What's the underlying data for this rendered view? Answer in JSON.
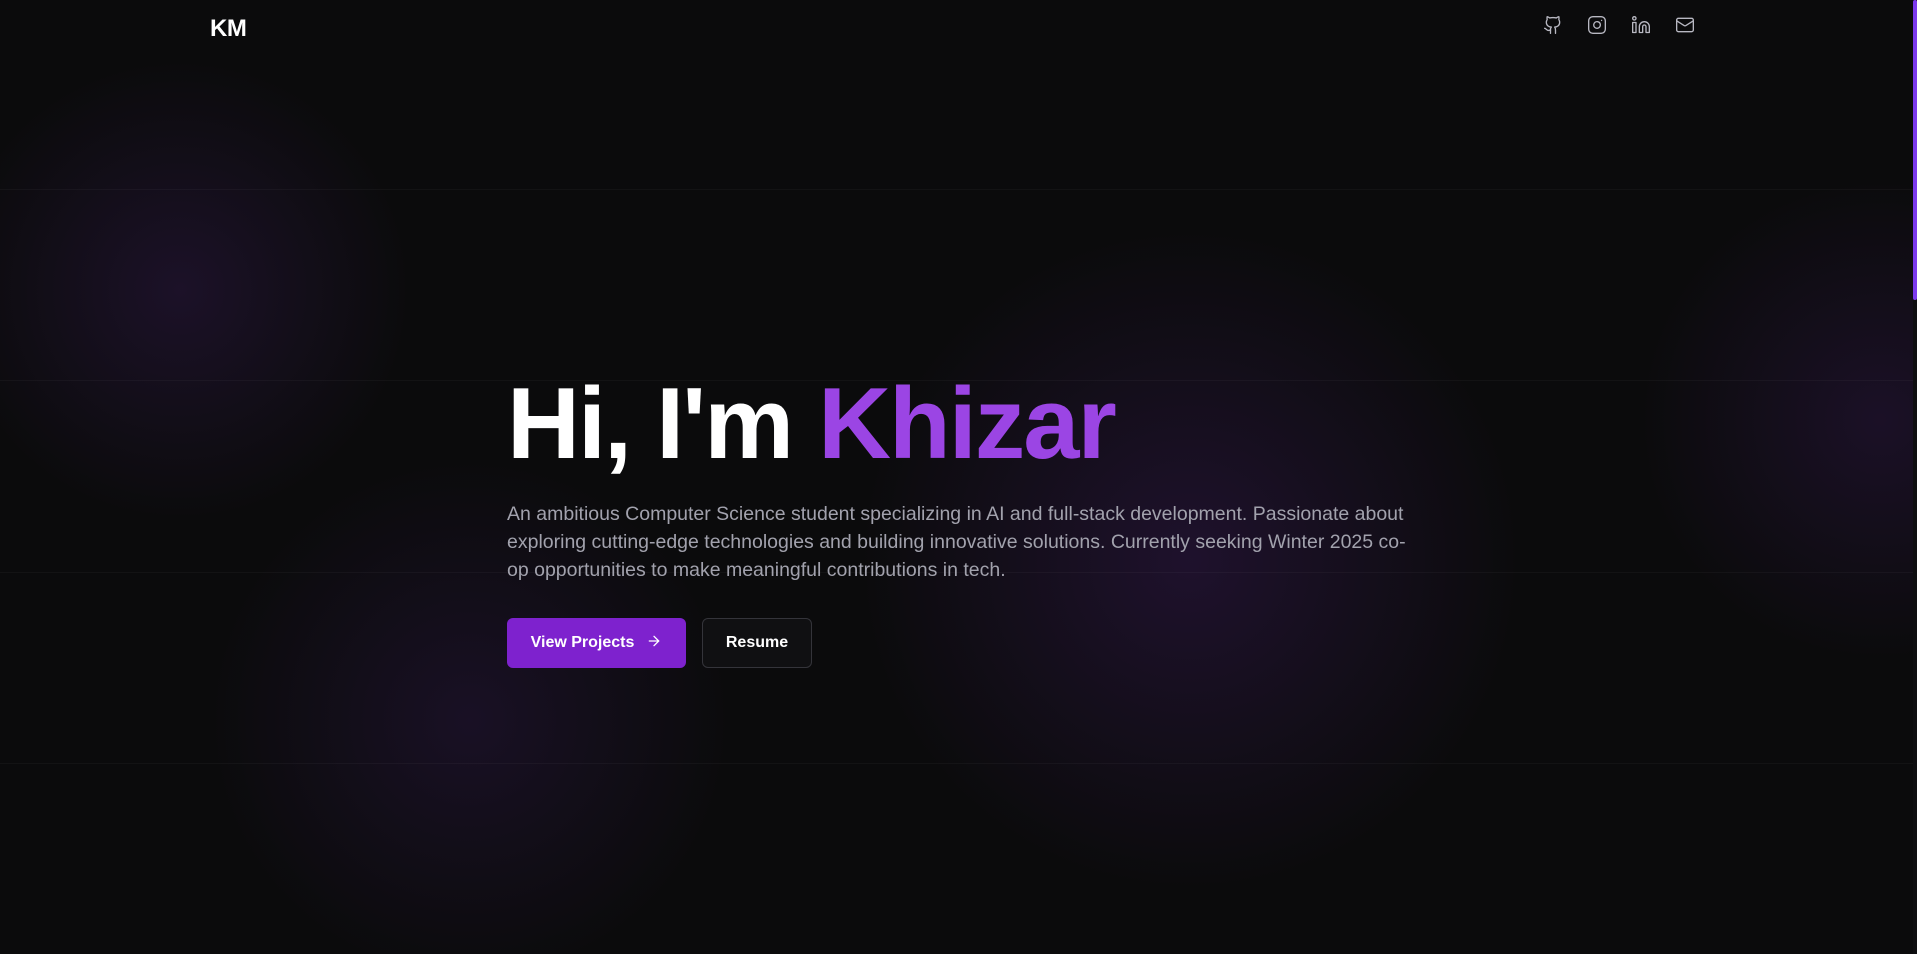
{
  "header": {
    "logo": "KM",
    "social_links": [
      {
        "icon": "github-icon",
        "name": "GitHub"
      },
      {
        "icon": "instagram-icon",
        "name": "Instagram"
      },
      {
        "icon": "linkedin-icon",
        "name": "LinkedIn"
      },
      {
        "icon": "mail-icon",
        "name": "Email"
      }
    ]
  },
  "hero": {
    "greeting": "Hi, I'm",
    "name": "Khizar",
    "description": "An ambitious Computer Science student specializing in AI and full-stack development. Passionate about exploring cutting-edge technologies and building innovative solutions. Currently seeking Winter 2025 co-op opportunities to make meaningful contributions in tech.",
    "primary_button": "View Projects",
    "secondary_button": "Resume"
  },
  "colors": {
    "background": "#0b0b0c",
    "accent": "#9b45e4",
    "button_primary": "#7e22ce",
    "text_muted": "#a2a2ad"
  }
}
